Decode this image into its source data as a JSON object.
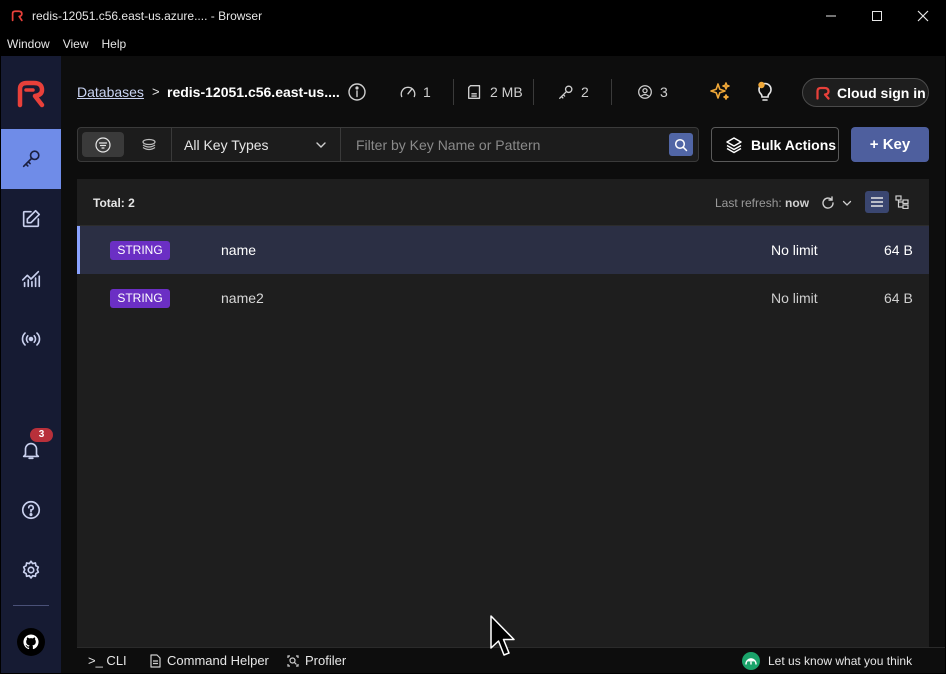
{
  "window": {
    "title": "redis-12051.c56.east-us.azure.... - Browser",
    "menu": [
      "Window",
      "View",
      "Help"
    ]
  },
  "colors": {
    "sidebar_bg": "#161b33",
    "active_nav": "#6f8ce8",
    "primary_button": "#4e5f9e",
    "string_badge": "#6b2fc4",
    "notification_badge": "#b8303a",
    "feedback_icon": "#1aa36a"
  },
  "sidebar": {
    "items": [
      {
        "name": "browser",
        "icon": "key-icon",
        "active": true
      },
      {
        "name": "workbench",
        "icon": "edit-icon",
        "active": false
      },
      {
        "name": "analysis",
        "icon": "analytics-icon",
        "active": false
      },
      {
        "name": "pubsub",
        "icon": "broadcast-icon",
        "active": false
      }
    ],
    "notification_count": "3"
  },
  "header": {
    "breadcrumb_link": "Databases",
    "breadcrumb_sep": ">",
    "database_name": "redis-12051.c56.east-us....",
    "stats": {
      "ops": "1",
      "memory": "2 MB",
      "keys": "2",
      "clients": "3"
    },
    "cloud_button": "Cloud sign in"
  },
  "toolbar": {
    "key_type_select": "All Key Types",
    "search_placeholder": "Filter by Key Name or Pattern",
    "bulk_actions": "Bulk Actions",
    "add_key": "+ Key"
  },
  "list": {
    "total": "Total: 2",
    "last_refresh_label": "Last refresh:",
    "last_refresh_value": "now",
    "rows": [
      {
        "type": "STRING",
        "name": "name",
        "ttl": "No limit",
        "size": "64 B",
        "selected": true
      },
      {
        "type": "STRING",
        "name": "name2",
        "ttl": "No limit",
        "size": "64 B",
        "selected": false
      }
    ]
  },
  "bottombar": {
    "cli": ">_ CLI",
    "command_helper": "Command Helper",
    "profiler": "Profiler",
    "feedback": "Let us know what you think"
  }
}
